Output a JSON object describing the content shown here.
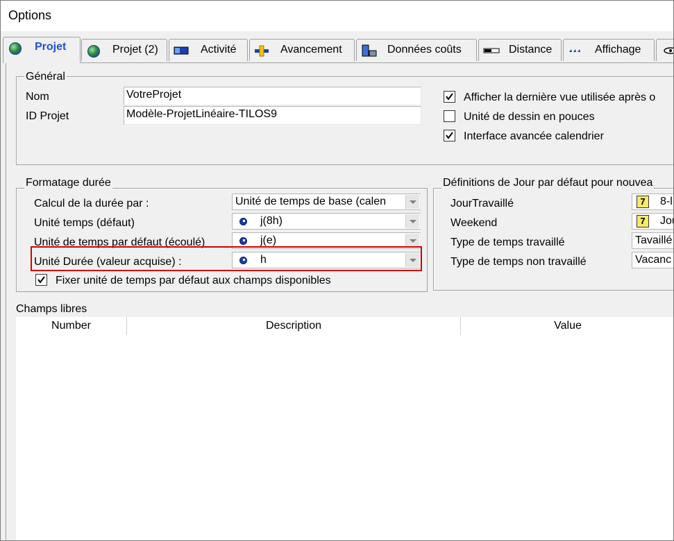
{
  "window": {
    "title": "Options"
  },
  "tabs": [
    {
      "label": "Projet",
      "icon": "globe-icon",
      "active": true
    },
    {
      "label": "Projet (2)",
      "icon": "globe-icon",
      "active": false
    },
    {
      "label": "Activité",
      "icon": "activity-bar-icon",
      "active": false
    },
    {
      "label": "Avancement",
      "icon": "progress-icon",
      "active": false
    },
    {
      "label": "Données coûts",
      "icon": "cost-data-icon",
      "active": false
    },
    {
      "label": "Distance",
      "icon": "distance-icon",
      "active": false
    },
    {
      "label": "Affichage",
      "icon": "display-icon",
      "active": false
    }
  ],
  "general": {
    "legend": "Général",
    "name_label": "Nom",
    "name_value": "VotreProjet",
    "id_label": "ID Projet",
    "id_value": "Modèle-ProjetLinéaire-TILOS9",
    "options": [
      {
        "label": "Afficher la dernière vue utilisée après o",
        "checked": true
      },
      {
        "label": "Unité de dessin en pouces",
        "checked": false
      },
      {
        "label": "Interface avancée calendrier",
        "checked": true
      }
    ]
  },
  "duration": {
    "legend": "Formatage durée",
    "rows": [
      {
        "label": "Calcul de la durée par :",
        "value": "Unité de temps de base (calen",
        "icon": ""
      },
      {
        "label": "Unité temps (défaut)",
        "value": "j(8h)",
        "icon": "clock-icon"
      },
      {
        "label": "Unité de temps par défaut (écoulé)",
        "value": "j(e)",
        "icon": "clock-icon"
      },
      {
        "label": "Unité Durée (valeur acquise) :",
        "value": "h",
        "icon": "clock-icon"
      }
    ],
    "fix_checkbox_label": "Fixer unité de temps par défaut aux champs disponibles",
    "fix_checked": true
  },
  "day_defs": {
    "legend": "Définitions de Jour par défaut pour nouvea",
    "rows": [
      {
        "label": "JourTravaillé",
        "value": "8-l",
        "icon": "calendar-icon"
      },
      {
        "label": "Weekend",
        "value": "Jou",
        "icon": "calendar-icon"
      },
      {
        "label": "Type de temps travaillé",
        "value": "Tavaillé",
        "icon": ""
      },
      {
        "label": "Type de temps non travaillé",
        "value": "Vacanc",
        "icon": ""
      }
    ]
  },
  "free_fields": {
    "title": "Champs libres",
    "columns": [
      "Number",
      "Description",
      "Value"
    ]
  }
}
